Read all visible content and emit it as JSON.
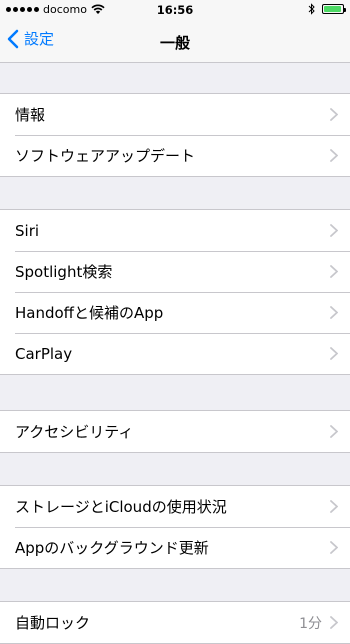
{
  "status_bar": {
    "carrier": "docomo",
    "time": "16:56",
    "battery_percent": 95,
    "battery_color": "#4cd964",
    "icons": [
      "signal-dots-icon",
      "wifi-icon",
      "bluetooth-icon",
      "battery-icon"
    ]
  },
  "nav": {
    "back_label": "設定",
    "title": "一般",
    "accent_color": "#007aff"
  },
  "groups": [
    {
      "items": [
        {
          "label": "情報"
        },
        {
          "label": "ソフトウェアアップデート"
        }
      ]
    },
    {
      "items": [
        {
          "label": "Siri"
        },
        {
          "label": "Spotlight検索"
        },
        {
          "label": "Handoffと候補のApp"
        },
        {
          "label": "CarPlay"
        }
      ]
    },
    {
      "items": [
        {
          "label": "アクセシビリティ"
        }
      ]
    },
    {
      "items": [
        {
          "label": "ストレージとiCloudの使用状況"
        },
        {
          "label": "Appのバックグラウンド更新"
        }
      ]
    },
    {
      "items": [
        {
          "label": "自動ロック",
          "value": "1分"
        }
      ]
    }
  ]
}
